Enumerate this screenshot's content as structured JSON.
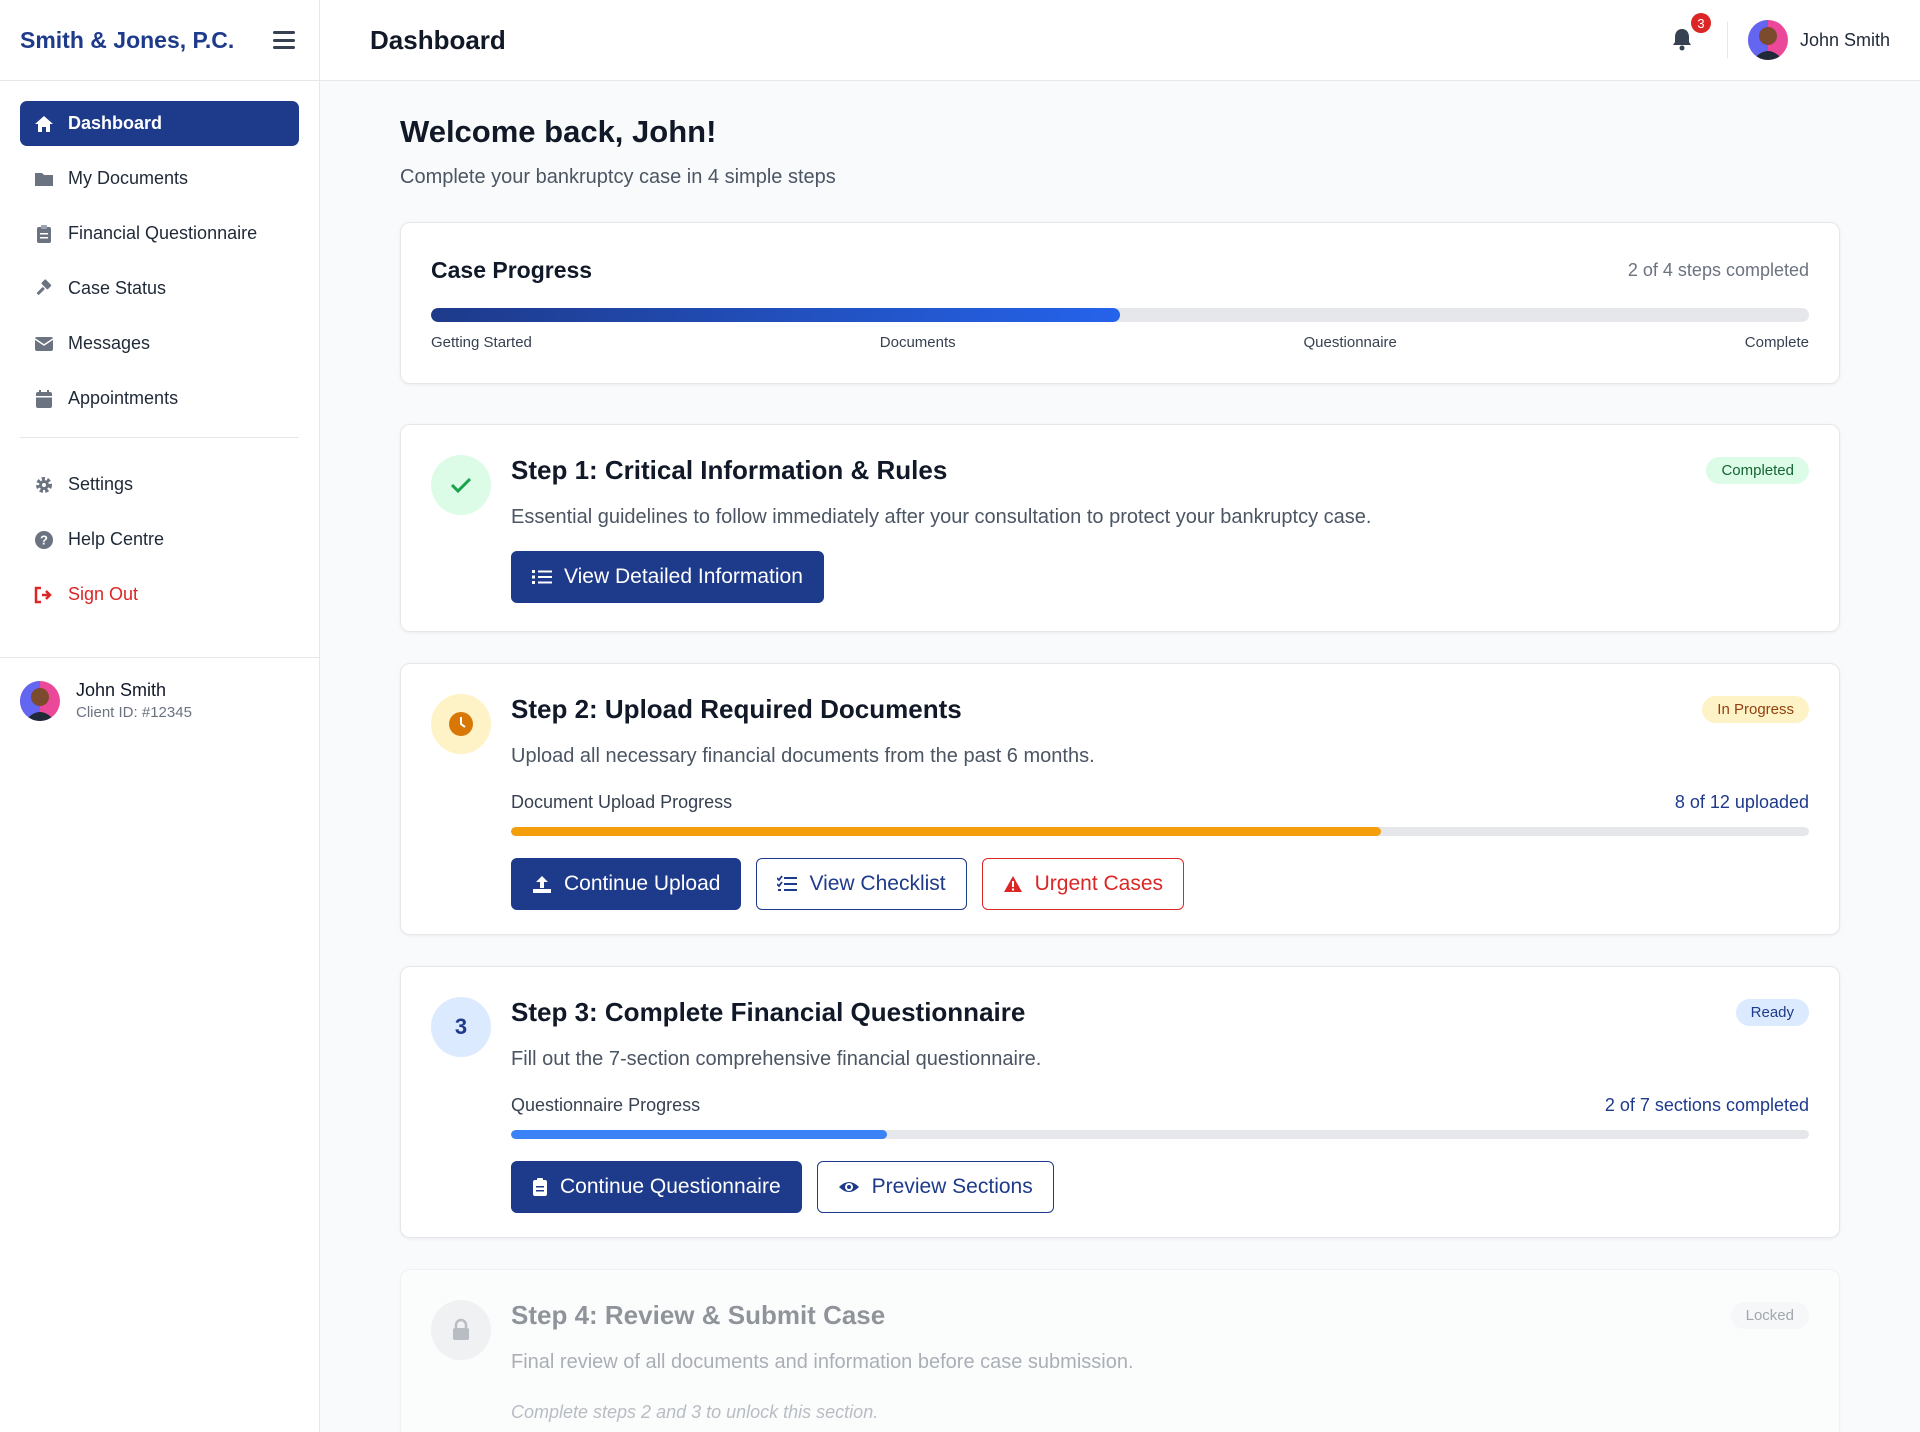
{
  "sidebar": {
    "brand": "Smith & Jones, P.C.",
    "nav": [
      {
        "label": "Dashboard",
        "icon": "home-icon",
        "active": true
      },
      {
        "label": "My Documents",
        "icon": "folder-icon"
      },
      {
        "label": "Financial Questionnaire",
        "icon": "clipboard-icon"
      },
      {
        "label": "Case Status",
        "icon": "gavel-icon"
      },
      {
        "label": "Messages",
        "icon": "envelope-icon"
      },
      {
        "label": "Appointments",
        "icon": "calendar-icon"
      }
    ],
    "secondary": [
      {
        "label": "Settings",
        "icon": "gear-icon"
      },
      {
        "label": "Help Centre",
        "icon": "question-circle-icon"
      },
      {
        "label": "Sign Out",
        "icon": "sign-out-icon"
      }
    ],
    "user": {
      "name": "John Smith",
      "client_id": "Client ID: #12345"
    }
  },
  "topbar": {
    "title": "Dashboard",
    "notifications": "3",
    "user_name": "John Smith"
  },
  "main": {
    "welcome": "Welcome back, John!",
    "subtitle": "Complete your bankruptcy case in 4 simple steps",
    "case_progress": {
      "title": "Case Progress",
      "count": "2 of 4 steps completed",
      "value": 0.5,
      "labels": [
        "Getting Started",
        "Documents",
        "Questionnaire",
        "Complete"
      ]
    },
    "steps": [
      {
        "title": "Step 1: Critical Information & Rules",
        "desc": "Essential guidelines to follow immediately after your consultation to protect your bankruptcy case.",
        "badge": "Completed",
        "buttons": [
          "View Detailed Information"
        ]
      },
      {
        "title": "Step 2: Upload Required Documents",
        "desc": "Upload all necessary financial documents from the past 6 months.",
        "badge": "In Progress",
        "progress_label": "Document Upload Progress",
        "progress_count": "8 of 12 uploaded",
        "progress_value": 0.67,
        "buttons": [
          "Continue Upload",
          "View Checklist",
          "Urgent Cases"
        ]
      },
      {
        "number": "3",
        "title": "Step 3: Complete Financial Questionnaire",
        "desc": "Fill out the 7-section comprehensive financial questionnaire.",
        "badge": "Ready",
        "progress_label": "Questionnaire Progress",
        "progress_count": "2 of 7 sections completed",
        "progress_value": 0.29,
        "buttons": [
          "Continue Questionnaire",
          "Preview Sections"
        ]
      },
      {
        "title": "Step 4: Review & Submit Case",
        "desc": "Final review of all documents and information before case submission.",
        "badge": "Locked",
        "note": "Complete steps 2 and 3 to unlock this section."
      }
    ]
  },
  "colors": {
    "primary": "#1e3a8a",
    "success": "#16a34a",
    "warning": "#f59e0b",
    "danger": "#dc2626",
    "info": "#3b82f6"
  }
}
